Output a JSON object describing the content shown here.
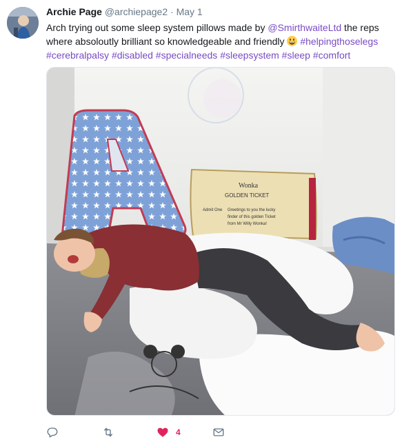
{
  "tweet": {
    "author_name": "Archie Page",
    "author_handle": "@archiepage2",
    "separator": "·",
    "date": "May 1",
    "text_part1": "Arch trying out some sleep system pillows made by ",
    "mention": "@SmirthwaiteLtd",
    "text_part2": " the reps where absoloutly brilliant so knowledgeable and friendly ",
    "hashtags": [
      "#helpingthoselegs",
      "#cerebralpalsy",
      "#disabled",
      "#specialneeds",
      "#sleepsystem",
      "#sleep",
      "#comfort"
    ],
    "photo_text": {
      "ticket_title": "Wonka",
      "ticket_subtitle": "GOLDEN TICKET",
      "ticket_side": "Admit One",
      "ticket_line1": "Greetings to you the lucky",
      "ticket_line2": "finder of this golden Ticket",
      "ticket_line3": "from Mr Willy Wonka!"
    },
    "likes_count": "4"
  },
  "colors": {
    "link": "#794bc4",
    "like": "#e0245e",
    "muted": "#657786"
  },
  "icons": [
    "reply-icon",
    "retweet-icon",
    "heart-icon",
    "envelope-icon",
    "grinning-emoji"
  ]
}
